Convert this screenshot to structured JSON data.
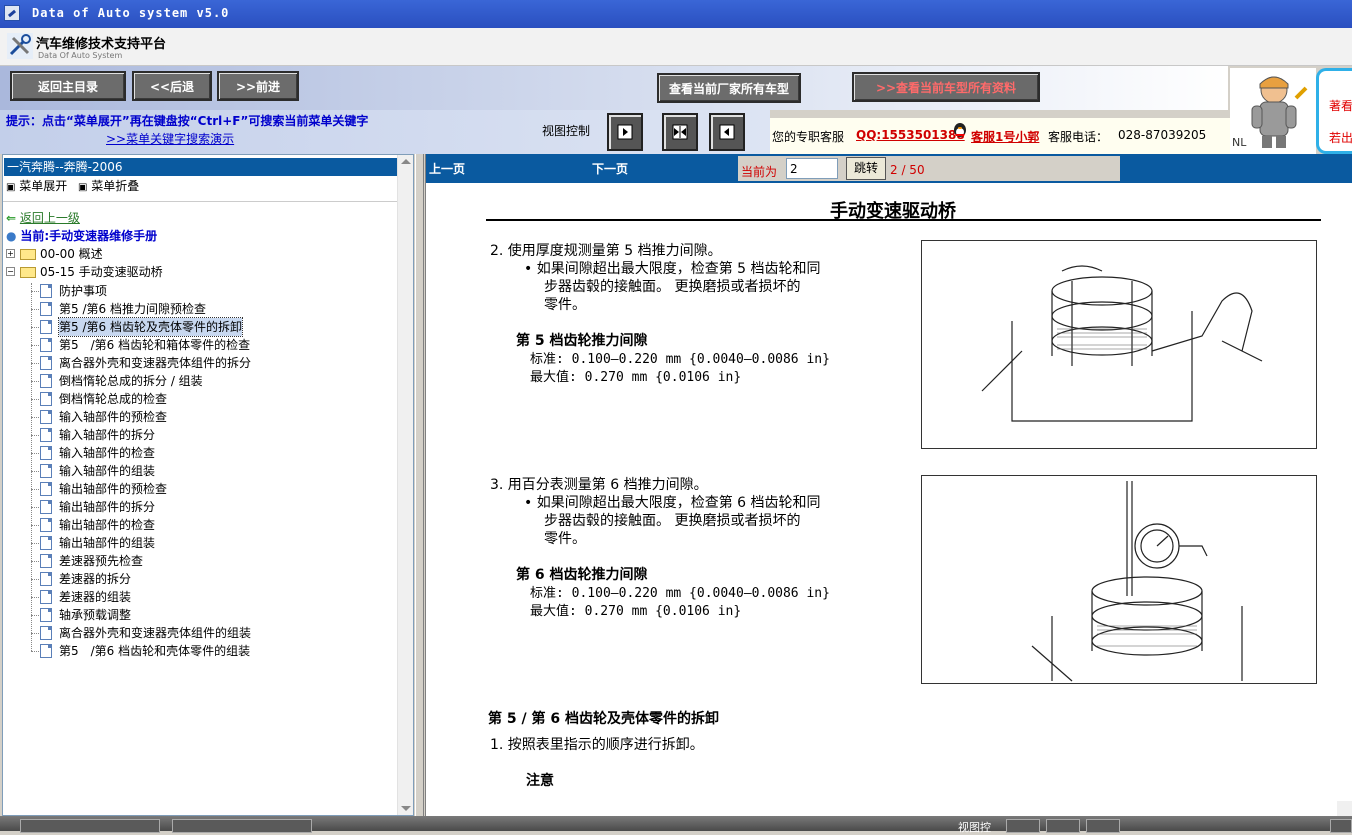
{
  "window": {
    "title": "Data of Auto system v5.0"
  },
  "brand": {
    "title": "汽车维修技术支持平台",
    "subtitle": "Data Of Auto System"
  },
  "toolbar": {
    "back_main": "返回主目录",
    "back": "<<后退",
    "forward": ">>前进",
    "all_models": "查看当前厂家所有车型",
    "all_docs": ">>查看当前车型所有资料"
  },
  "hint": {
    "text": "提示：点击“菜单展开”再在键盘按“Ctrl+F”可搜索当前菜单关键字",
    "demo_link": ">>菜单关键字搜索演示"
  },
  "view_control": {
    "label": "视图控制"
  },
  "service": {
    "prefix": "您的专职客服",
    "qq": "QQ:1553501388",
    "agent": "客服1号小郭",
    "phone_label": "客服电话：",
    "phone": "028-87039205",
    "nl": "NL"
  },
  "right_badge": {
    "line1": "著看",
    "line2": "若出"
  },
  "tree": {
    "model": "一汽奔腾--奔腾-2006",
    "expand": "菜单展开",
    "collapse": "菜单折叠",
    "up": "返回上一级",
    "current": "当前:手动变速器维修手册",
    "folder1": "00-00 概述",
    "folder2": "05-15 手动变速驱动桥",
    "items": [
      "防护事项",
      "第5 /第6 档推力间隙预检查",
      "第5 /第6 档齿轮及壳体零件的拆卸",
      "第5　/第6 档齿轮和箱体零件的检查",
      "离合器外壳和变速器壳体组件的拆分",
      "倒档惰轮总成的拆分 / 组装",
      "倒档惰轮总成的检查",
      "输入轴部件的预检查",
      "输入轴部件的拆分",
      "输入轴部件的检查",
      "输入轴部件的组装",
      "输出轴部件的预检查",
      "输出轴部件的拆分",
      "输出轴部件的检查",
      "输出轴部件的组装",
      "差速器预先检查",
      "差速器的拆分",
      "差速器的组装",
      "轴承预载调整",
      "离合器外壳和变速器壳体组件的组装",
      "第5　/第6 档齿轮和壳体零件的组装"
    ]
  },
  "pager": {
    "prev": "上一页",
    "next": "下一页",
    "current_label": "当前为",
    "current_value": "2",
    "jump": "跳转",
    "total": "2 / 50"
  },
  "doc": {
    "title": "手动变速驱动桥",
    "step2": "2.  使用厚度规测量第 5 档推力间隙。",
    "step2_bullet1": "•  如果间隙超出最大限度，检查第 5 档齿轮和同",
    "step2_bullet2": "步器齿毂的接触面。 更换磨损或者损坏的",
    "step2_bullet3": "零件。",
    "spec5_title": "第 5 档齿轮推力间隙",
    "spec5_std": "标准:  0.100—0.220 mm {0.0040—0.0086 in}",
    "spec5_max": "最大值:  0.270 mm {0.0106 in}",
    "step3": "3.  用百分表测量第 6 档推力间隙。",
    "step3_bullet1": "•  如果间隙超出最大限度，检查第 6 档齿轮和同",
    "step3_bullet2": "步器齿毂的接触面。 更换磨损或者损坏的",
    "step3_bullet3": "零件。",
    "spec6_title": "第 6 档齿轮推力间隙",
    "spec6_std": "标准:  0.100—0.220 mm {0.0040—0.0086 in}",
    "spec6_max": "最大值:  0.270 mm {0.0106 in}",
    "section_title": "第 5 / 第 6 档齿轮及壳体零件的拆卸",
    "section_step1": "1.  按照表里指示的顺序进行拆卸。",
    "note": "注意"
  },
  "bottom": {
    "view_label": "视图控"
  }
}
